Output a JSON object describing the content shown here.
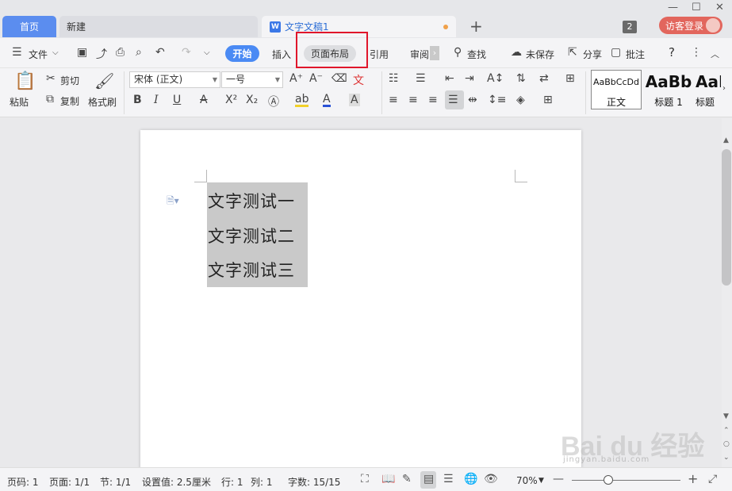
{
  "tabs": {
    "home": "首页",
    "new": "新建",
    "doc": "文字文稿1",
    "doc_icon": "W",
    "plus": "+",
    "badge": "2",
    "login": "访客登录"
  },
  "window": {
    "minimize": "—",
    "maximize": "☐",
    "close": "✕"
  },
  "menu": {
    "file": "文件",
    "start": "开始",
    "insert": "插入",
    "layout": "页面布局",
    "reference": "引用",
    "review": "审阅",
    "find": "查找",
    "unsaved": "未保存",
    "share": "分享",
    "comment": "批注",
    "help": "?"
  },
  "ribbon": {
    "paste": "粘贴",
    "cut": "剪切",
    "copy": "复制",
    "format_painter": "格式刷",
    "font_name": "宋体 (正文)",
    "font_size": "一号",
    "styles": [
      {
        "preview": "AaBbCcDd",
        "name": "正文"
      },
      {
        "preview": "AaBb",
        "name": "标题 1"
      },
      {
        "preview": "AaI",
        "name": "标题"
      }
    ]
  },
  "document": {
    "lines": [
      "文字测试一",
      "文字测试二",
      "文字测试三"
    ]
  },
  "status": {
    "page_num": "页码: 1",
    "pages": "页面: 1/1",
    "section": "节: 1/1",
    "setting": "设置值: 2.5厘米",
    "row": "行: 1",
    "col": "列: 1",
    "words": "字数: 15/15",
    "zoom": "70%",
    "zoom_level_percent": 70
  },
  "watermark": {
    "main": "Bai du 经验",
    "sub": "jingyan.baidu.com"
  },
  "colors": {
    "accent": "#4a8af4",
    "login": "#e2665d",
    "highlight": "#e0162b"
  }
}
